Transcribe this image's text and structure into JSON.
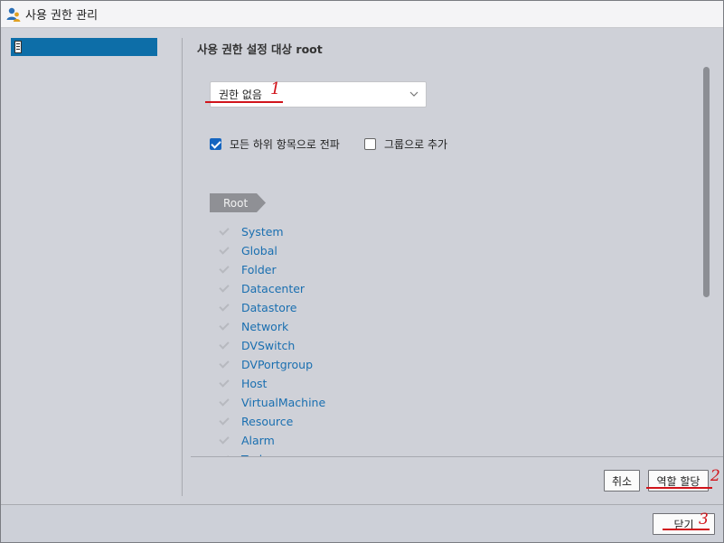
{
  "window": {
    "title": "사용 권한 관리"
  },
  "sidebar": {
    "items": [
      {
        "label": ""
      }
    ]
  },
  "main": {
    "title": "사용 권한 설정 대상 root",
    "role_select": {
      "value": "권한 없음"
    },
    "options": {
      "propagate_label": "모든 하위 항목으로 전파",
      "propagate_checked": true,
      "add_as_group_label": "그룹으로 추가",
      "add_as_group_checked": false
    },
    "breadcrumb": "Root",
    "privileges": [
      "System",
      "Global",
      "Folder",
      "Datacenter",
      "Datastore",
      "Network",
      "DVSwitch",
      "DVPortgroup",
      "Host",
      "VirtualMachine",
      "Resource",
      "Alarm",
      "Task"
    ],
    "buttons": {
      "cancel": "취소",
      "assign_role": "역할 할당"
    }
  },
  "footer": {
    "close": "닫기"
  },
  "annotations": {
    "step1": "1",
    "step2": "2",
    "step3": "3",
    "color": "#d1141b"
  }
}
